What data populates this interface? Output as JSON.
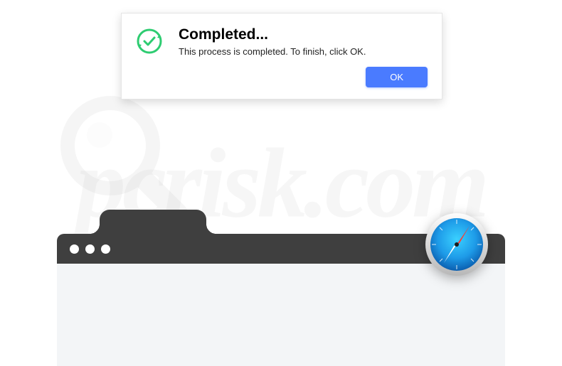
{
  "dialog": {
    "title": "Completed...",
    "message": "This process is completed. To finish, click OK.",
    "ok_label": "OK"
  },
  "watermark": {
    "text": "pcrisk.com"
  },
  "colors": {
    "accent": "#4a7bff",
    "success": "#2ecc71",
    "dark": "#3f3f3f"
  }
}
